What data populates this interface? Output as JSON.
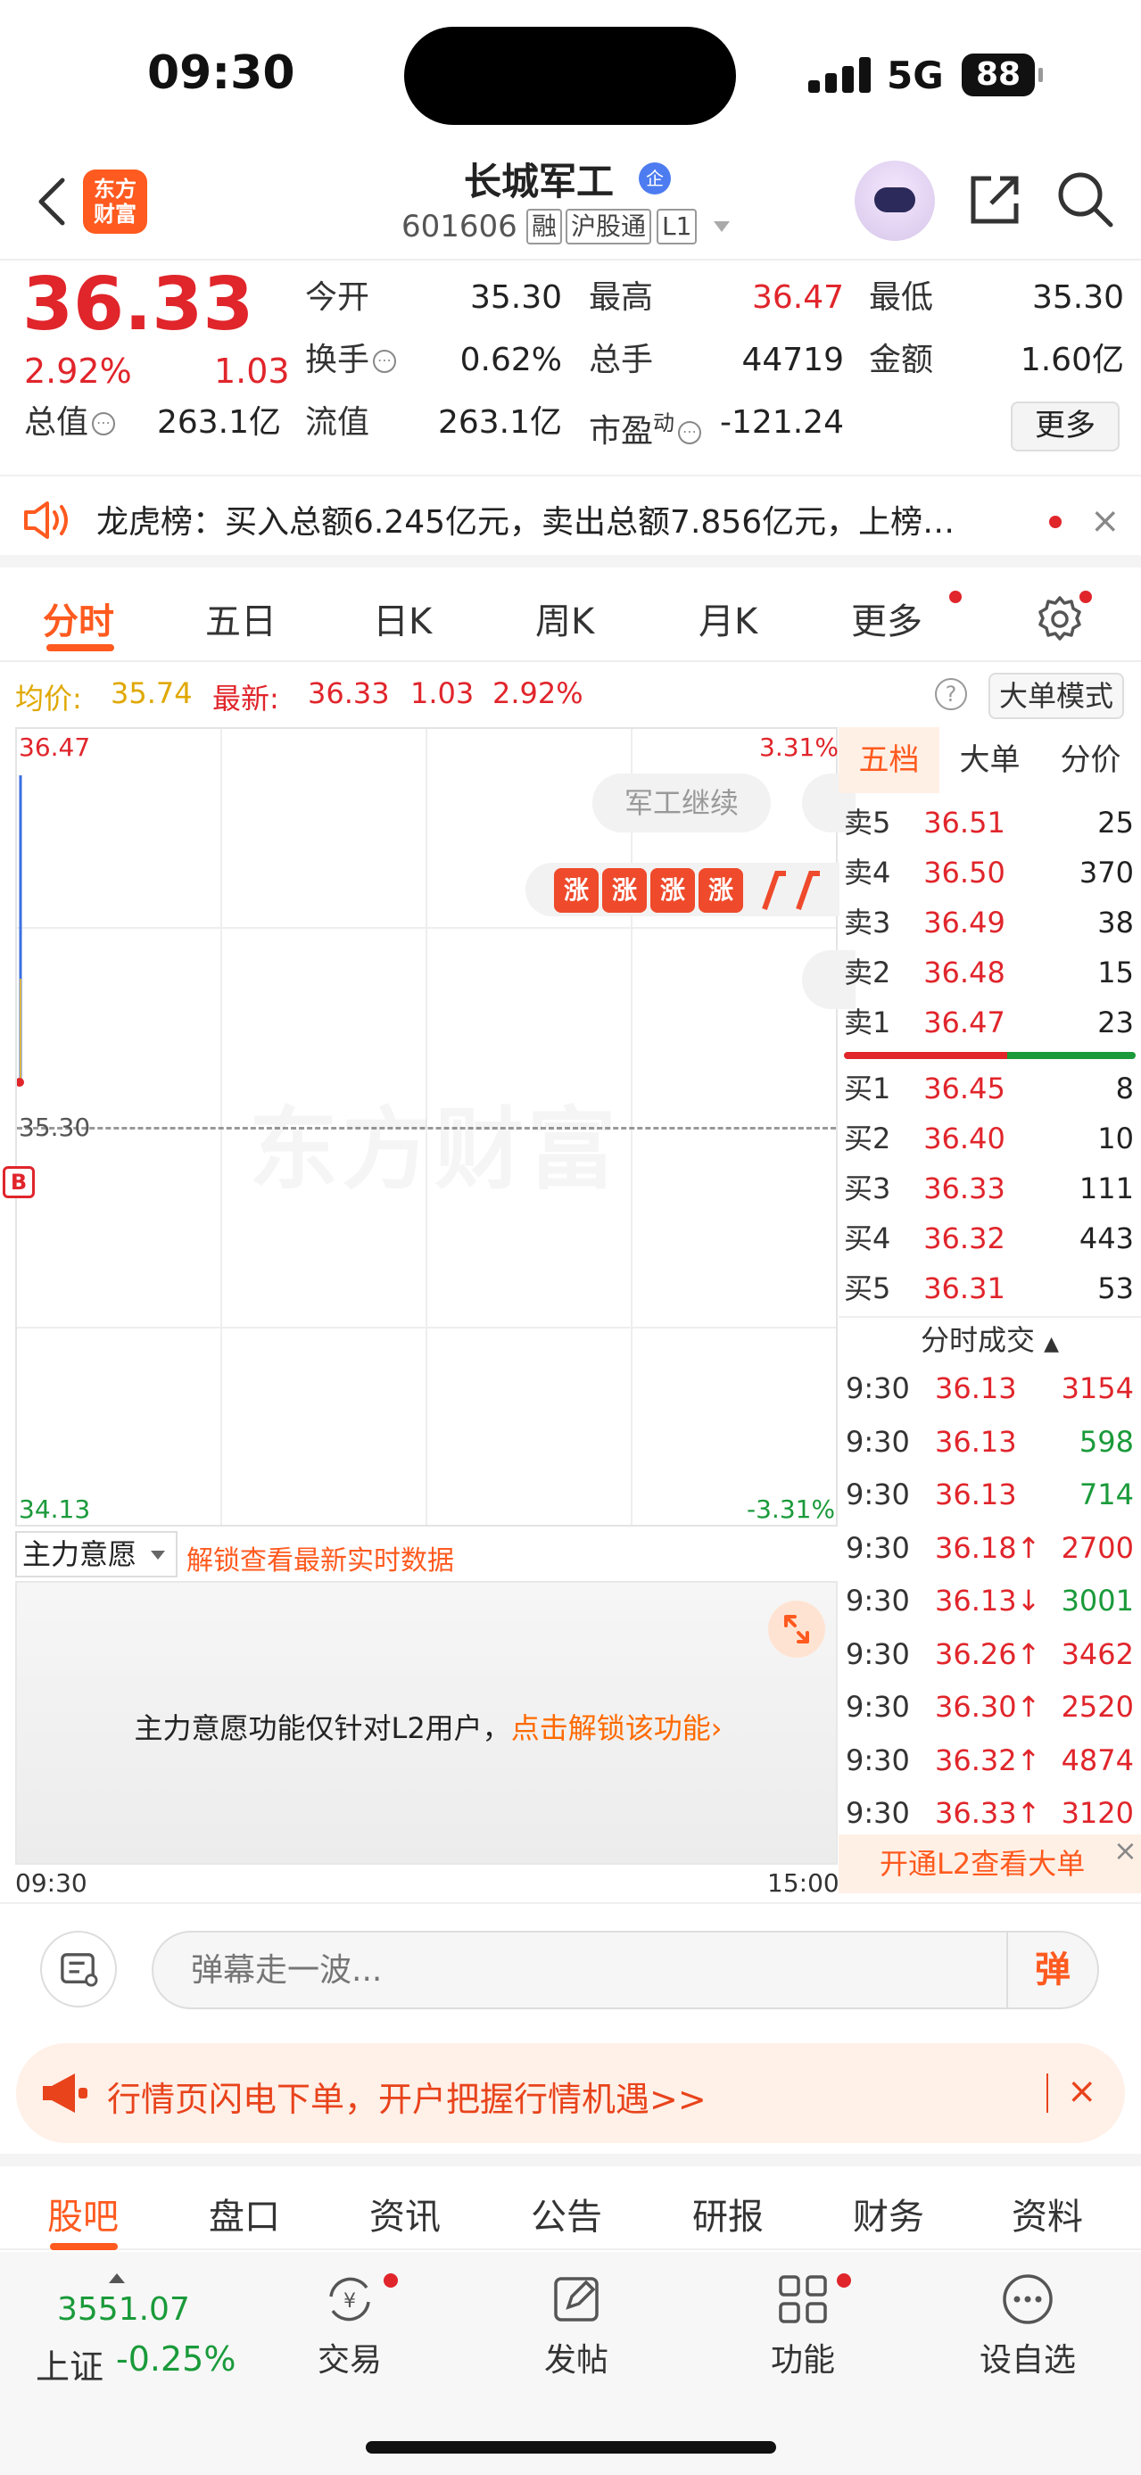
{
  "status": {
    "time": "09:30",
    "network": "5G",
    "battery": "88"
  },
  "header": {
    "logo_line1": "东方",
    "logo_line2": "财富",
    "stock_name": "长城军工",
    "verify_badge": "企",
    "stock_code": "601606",
    "tags": [
      "融",
      "沪股通",
      "L1"
    ]
  },
  "quote": {
    "price": "36.33",
    "pct": "2.92%",
    "change": "1.03",
    "fields": [
      {
        "label": "今开",
        "value": "35.30",
        "color": "black"
      },
      {
        "label": "最高",
        "value": "36.47",
        "color": "red"
      },
      {
        "label": "最低",
        "value": "35.30",
        "color": "black"
      },
      {
        "label": "换手",
        "value": "0.62%",
        "color": "black"
      },
      {
        "label": "总手",
        "value": "44719",
        "color": "black"
      },
      {
        "label": "金额",
        "value": "1.60亿",
        "color": "black"
      },
      {
        "label": "总值",
        "value": "263.1亿",
        "color": "black"
      },
      {
        "label": "流值",
        "value": "263.1亿",
        "color": "black"
      },
      {
        "label": "市盈",
        "value": "-121.24",
        "color": "black"
      }
    ],
    "pe_superscript": "动",
    "more_label": "更多"
  },
  "longhu": {
    "text": "龙虎榜：买入总额6.245亿元，卖出总额7.856亿元，上榜…"
  },
  "chart_tabs": [
    "分时",
    "五日",
    "日K",
    "周K",
    "月K",
    "更多"
  ],
  "avg": {
    "avg_label": "均价:",
    "avg_value": "35.74",
    "latest_label": "最新:",
    "latest_value": "36.33",
    "latest_change": "1.03",
    "latest_pct": "2.92%",
    "help": "?",
    "big_order_label": "大单模式"
  },
  "chart": {
    "y_high": "36.47",
    "y_ref": "35.30",
    "y_low": "34.13",
    "pct_high": "3.31%",
    "pct_low": "-3.31%",
    "watermark": "东方财富",
    "pill_label": "军工继续",
    "zhang_chars": [
      "涨",
      "涨",
      "涨",
      "涨"
    ],
    "b_marker": "B",
    "time_start": "09:30",
    "time_end": "15:00"
  },
  "book": {
    "tabs": [
      "五档",
      "大单",
      "分价"
    ],
    "asks": [
      {
        "level": "卖5",
        "price": "36.51",
        "vol": "25"
      },
      {
        "level": "卖4",
        "price": "36.50",
        "vol": "370"
      },
      {
        "level": "卖3",
        "price": "36.49",
        "vol": "38"
      },
      {
        "level": "卖2",
        "price": "36.48",
        "vol": "15"
      },
      {
        "level": "卖1",
        "price": "36.47",
        "vol": "23"
      }
    ],
    "bids": [
      {
        "level": "买1",
        "price": "36.45",
        "vol": "8"
      },
      {
        "level": "买2",
        "price": "36.40",
        "vol": "10"
      },
      {
        "level": "买3",
        "price": "36.33",
        "vol": "111"
      },
      {
        "level": "买4",
        "price": "36.32",
        "vol": "443"
      },
      {
        "level": "买5",
        "price": "36.31",
        "vol": "53"
      }
    ],
    "ticks_title": "分时成交",
    "ticks": [
      {
        "time": "9:30",
        "price": "36.13",
        "vol": "3154",
        "dir": "none",
        "vcolor": "red"
      },
      {
        "time": "9:30",
        "price": "36.13",
        "vol": "598",
        "dir": "none",
        "vcolor": "green"
      },
      {
        "time": "9:30",
        "price": "36.13",
        "vol": "714",
        "dir": "none",
        "vcolor": "green"
      },
      {
        "time": "9:30",
        "price": "36.18↑",
        "vol": "2700",
        "dir": "up",
        "vcolor": "red"
      },
      {
        "time": "9:30",
        "price": "36.13↓",
        "vol": "3001",
        "dir": "down",
        "vcolor": "green"
      },
      {
        "time": "9:30",
        "price": "36.26↑",
        "vol": "3462",
        "dir": "up",
        "vcolor": "red"
      },
      {
        "time": "9:30",
        "price": "36.30↑",
        "vol": "2520",
        "dir": "up",
        "vcolor": "red"
      },
      {
        "time": "9:30",
        "price": "36.32↑",
        "vol": "4874",
        "dir": "up",
        "vcolor": "red"
      },
      {
        "time": "9:30",
        "price": "36.33↑",
        "vol": "3120",
        "dir": "up",
        "vcolor": "red"
      }
    ],
    "l2_label": "开通L2查看大单"
  },
  "main_force": {
    "select_label": "主力意愿",
    "unlock_text": "解锁查看最新实时数据",
    "panel_text": "主力意愿功能仅针对L2用户，",
    "panel_link": "点击解锁该功能"
  },
  "danmu": {
    "placeholder": "弹幕走一波...",
    "send_label": "弹"
  },
  "promo": {
    "text": "行情页闪电下单，开户把握行情机遇>>"
  },
  "bottom_tabs": [
    "股吧",
    "盘口",
    "资讯",
    "公告",
    "研报",
    "财务",
    "资料"
  ],
  "tabbar": {
    "index_value": "3551.07",
    "index_name": "上证",
    "index_change": "-0.25%",
    "items": [
      "交易",
      "发帖",
      "功能",
      "设自选"
    ]
  },
  "colors": {
    "up": "#e0252b",
    "down": "#1a9a3a",
    "accent": "#ff5a1f"
  }
}
